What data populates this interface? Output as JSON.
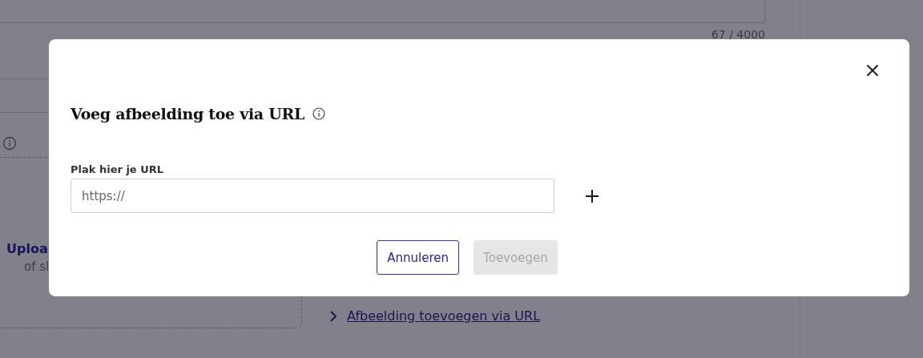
{
  "page": {
    "char_counter": "67 / 4000",
    "upload_title": "Uploa",
    "upload_subtitle": "of sl",
    "url_link": "Afbeelding toevoegen via URL"
  },
  "dialog": {
    "title": "Voeg afbeelding toe via URL",
    "field_label": "Plak hier je URL",
    "placeholder": "https://",
    "buttons": [
      {
        "label": "Annuleren",
        "kind": "secondary",
        "disabled": false
      },
      {
        "label": "Toevoegen",
        "kind": "primary",
        "disabled": true
      }
    ]
  }
}
